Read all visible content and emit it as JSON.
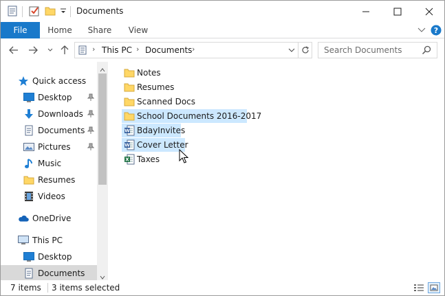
{
  "window": {
    "title": "Documents",
    "controls": {
      "minimize_icon": "minimize-icon",
      "maximize_icon": "maximize-icon",
      "close_icon": "close-icon"
    }
  },
  "quick_access_toolbar": {
    "icons": [
      "properties-icon",
      "checkmark-icon",
      "new-folder-icon",
      "customize-dropdown-icon"
    ]
  },
  "ribbon": {
    "tabs": [
      "File",
      "Home",
      "Share",
      "View"
    ],
    "file_color": "#1979ca"
  },
  "address_bar": {
    "crumbs": [
      "This PC",
      "Documents"
    ],
    "search_placeholder": "Search Documents"
  },
  "nav_pane": {
    "items": [
      {
        "label": "Quick access",
        "icon": "star-icon"
      },
      {
        "label": "Desktop",
        "icon": "desktop-icon",
        "pinned": true
      },
      {
        "label": "Downloads",
        "icon": "download-icon",
        "pinned": true
      },
      {
        "label": "Documents",
        "icon": "document-icon",
        "pinned": true
      },
      {
        "label": "Pictures",
        "icon": "pictures-icon",
        "pinned": true
      },
      {
        "label": "Music",
        "icon": "music-icon"
      },
      {
        "label": "Resumes",
        "icon": "folder-icon"
      },
      {
        "label": "Videos",
        "icon": "videos-icon"
      },
      {
        "label": "OneDrive",
        "icon": "cloud-icon"
      },
      {
        "label": "This PC",
        "icon": "computer-icon"
      },
      {
        "label": "Desktop",
        "icon": "desktop-icon"
      },
      {
        "label": "Documents",
        "icon": "document-icon",
        "selected": true
      }
    ]
  },
  "files": [
    {
      "name": "Notes",
      "icon": "folder-icon",
      "selected": false
    },
    {
      "name": "Resumes",
      "icon": "folder-icon",
      "selected": false
    },
    {
      "name": "Scanned Docs",
      "icon": "folder-icon",
      "selected": false
    },
    {
      "name": "School Documents 2016-2017",
      "icon": "folder-icon",
      "selected": true
    },
    {
      "name": "BdayInvites",
      "icon": "word-doc-icon",
      "selected": true
    },
    {
      "name": "Cover Letter",
      "icon": "word-doc-icon",
      "selected": true
    },
    {
      "name": "Taxes",
      "icon": "excel-doc-icon",
      "selected": false
    }
  ],
  "status_bar": {
    "item_count": "7 items",
    "selection": "3 items selected"
  },
  "colors": {
    "selection": "#cce8ff",
    "nav_selected": "#d9d9d9",
    "folder": "#ffd766",
    "accent": "#1979ca"
  }
}
